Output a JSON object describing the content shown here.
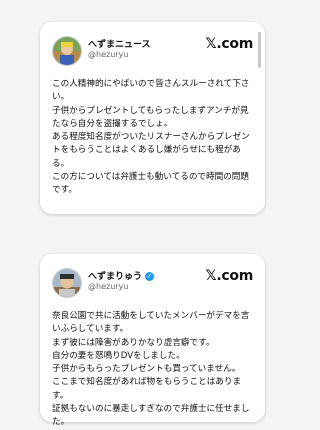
{
  "post1": {
    "name": "へずまニュース",
    "handle": "@hezuryu",
    "brand": "𝕏.com",
    "lines": [
      "この人精神的にやばいので皆さんスルーされて下さい。",
      "子供からプレゼントしてもらったしまずアンチが見たなら自分を盗撮するでしょ。",
      "ある程度知名度がついたリスナーさんからプレゼントをもらうことはよくあるし嫌がらせにも程がある。",
      "この方については弁護士も動いてるので時間の問題です。"
    ]
  },
  "post2": {
    "name": "へずまりゅう",
    "handle": "@hezuryu",
    "verified_color": "#1d9bf0",
    "brand": "𝕏.com",
    "lines": [
      "奈良公園で共に活動をしていたメンバーがデマを言いふらしています。",
      "まず彼には障害がありかなり虚言癖です。",
      "自分の妻を怒鳴りDVをしました。",
      "子供からもらったプレゼントも買っていません。",
      "ここまで知名度があれば物をもらうことはあります。",
      "証拠もないのに暴走しすぎなので弁護士に任せました。"
    ]
  }
}
